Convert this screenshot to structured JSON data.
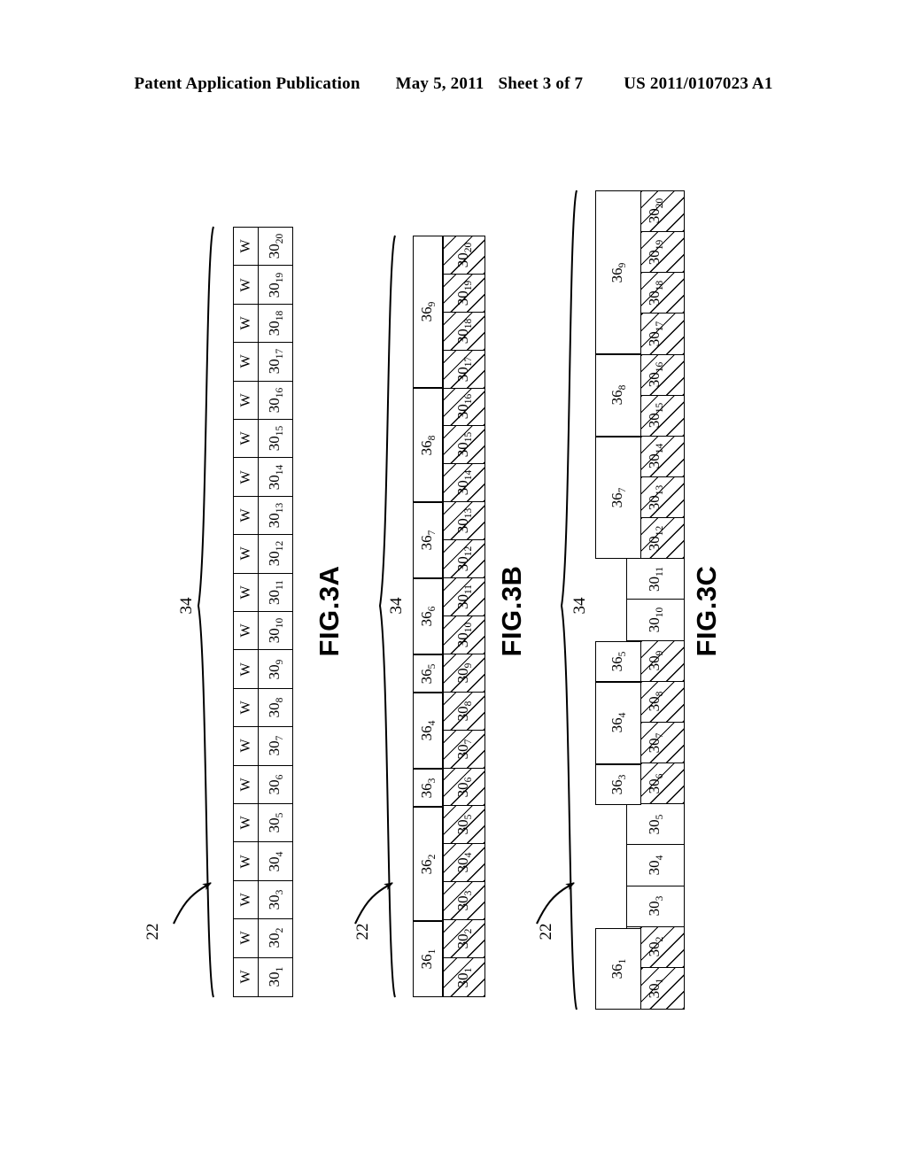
{
  "header": {
    "publication": "Patent Application Publication",
    "date": "May 5, 2011",
    "sheet": "Sheet 3 of 7",
    "patent_number": "US 2011/0107023 A1"
  },
  "figures": [
    {
      "id": "fig3a",
      "caption": "FIG.3A",
      "brace_label": "34",
      "leader_label": "22",
      "cell_w_label": "W",
      "cells": [
        {
          "base": "30",
          "sub": "1",
          "hatched": false,
          "w": true
        },
        {
          "base": "30",
          "sub": "2",
          "hatched": false,
          "w": true
        },
        {
          "base": "30",
          "sub": "3",
          "hatched": false,
          "w": true
        },
        {
          "base": "30",
          "sub": "4",
          "hatched": false,
          "w": true
        },
        {
          "base": "30",
          "sub": "5",
          "hatched": false,
          "w": true
        },
        {
          "base": "30",
          "sub": "6",
          "hatched": false,
          "w": true
        },
        {
          "base": "30",
          "sub": "7",
          "hatched": false,
          "w": true
        },
        {
          "base": "30",
          "sub": "8",
          "hatched": false,
          "w": true
        },
        {
          "base": "30",
          "sub": "9",
          "hatched": false,
          "w": true
        },
        {
          "base": "30",
          "sub": "10",
          "hatched": false,
          "w": true
        },
        {
          "base": "30",
          "sub": "11",
          "hatched": false,
          "w": true
        },
        {
          "base": "30",
          "sub": "12",
          "hatched": false,
          "w": true
        },
        {
          "base": "30",
          "sub": "13",
          "hatched": false,
          "w": true
        },
        {
          "base": "30",
          "sub": "14",
          "hatched": false,
          "w": true
        },
        {
          "base": "30",
          "sub": "15",
          "hatched": false,
          "w": true
        },
        {
          "base": "30",
          "sub": "16",
          "hatched": false,
          "w": true
        },
        {
          "base": "30",
          "sub": "17",
          "hatched": false,
          "w": true
        },
        {
          "base": "30",
          "sub": "18",
          "hatched": false,
          "w": true
        },
        {
          "base": "30",
          "sub": "19",
          "hatched": false,
          "w": true
        },
        {
          "base": "30",
          "sub": "20",
          "hatched": false,
          "w": true
        }
      ],
      "groups": []
    },
    {
      "id": "fig3b",
      "caption": "FIG.3B",
      "brace_label": "34",
      "leader_label": "22",
      "cell_w_label": "",
      "cells": [
        {
          "base": "30",
          "sub": "1",
          "hatched": true,
          "w": false
        },
        {
          "base": "30",
          "sub": "2",
          "hatched": true,
          "w": false
        },
        {
          "base": "30",
          "sub": "3",
          "hatched": true,
          "w": false
        },
        {
          "base": "30",
          "sub": "4",
          "hatched": true,
          "w": false
        },
        {
          "base": "30",
          "sub": "5",
          "hatched": true,
          "w": false
        },
        {
          "base": "30",
          "sub": "6",
          "hatched": true,
          "w": false
        },
        {
          "base": "30",
          "sub": "7",
          "hatched": true,
          "w": false
        },
        {
          "base": "30",
          "sub": "8",
          "hatched": true,
          "w": false
        },
        {
          "base": "30",
          "sub": "9",
          "hatched": true,
          "w": false
        },
        {
          "base": "30",
          "sub": "10",
          "hatched": true,
          "w": false
        },
        {
          "base": "30",
          "sub": "11",
          "hatched": true,
          "w": false
        },
        {
          "base": "30",
          "sub": "12",
          "hatched": true,
          "w": false
        },
        {
          "base": "30",
          "sub": "13",
          "hatched": true,
          "w": false
        },
        {
          "base": "30",
          "sub": "14",
          "hatched": true,
          "w": false
        },
        {
          "base": "30",
          "sub": "15",
          "hatched": true,
          "w": false
        },
        {
          "base": "30",
          "sub": "16",
          "hatched": true,
          "w": false
        },
        {
          "base": "30",
          "sub": "17",
          "hatched": true,
          "w": false
        },
        {
          "base": "30",
          "sub": "18",
          "hatched": true,
          "w": false
        },
        {
          "base": "30",
          "sub": "19",
          "hatched": true,
          "w": false
        },
        {
          "base": "30",
          "sub": "20",
          "hatched": true,
          "w": false
        }
      ],
      "groups": [
        {
          "base": "36",
          "sub": "1",
          "span": 2,
          "present": true,
          "hatched": true
        },
        {
          "base": "36",
          "sub": "2",
          "span": 3,
          "present": true,
          "hatched": true
        },
        {
          "base": "36",
          "sub": "3",
          "span": 1,
          "present": true,
          "hatched": true
        },
        {
          "base": "36",
          "sub": "4",
          "span": 2,
          "present": true,
          "hatched": true
        },
        {
          "base": "36",
          "sub": "5",
          "span": 1,
          "present": true,
          "hatched": true
        },
        {
          "base": "36",
          "sub": "6",
          "span": 2,
          "present": true,
          "hatched": true
        },
        {
          "base": "36",
          "sub": "7",
          "span": 2,
          "present": true,
          "hatched": true
        },
        {
          "base": "36",
          "sub": "8",
          "span": 3,
          "present": true,
          "hatched": true
        },
        {
          "base": "36",
          "sub": "9",
          "span": 4,
          "present": true,
          "hatched": true
        }
      ]
    },
    {
      "id": "fig3c",
      "caption": "FIG.3C",
      "brace_label": "34",
      "leader_label": "22",
      "cell_w_label": "",
      "cells": [
        {
          "base": "30",
          "sub": "1",
          "hatched": true,
          "w": false
        },
        {
          "base": "30",
          "sub": "2",
          "hatched": true,
          "w": false
        },
        {
          "base": "30",
          "sub": "3",
          "hatched": false,
          "w": false
        },
        {
          "base": "30",
          "sub": "4",
          "hatched": false,
          "w": false
        },
        {
          "base": "30",
          "sub": "5",
          "hatched": false,
          "w": false
        },
        {
          "base": "30",
          "sub": "6",
          "hatched": true,
          "w": false
        },
        {
          "base": "30",
          "sub": "7",
          "hatched": true,
          "w": false
        },
        {
          "base": "30",
          "sub": "8",
          "hatched": true,
          "w": false
        },
        {
          "base": "30",
          "sub": "9",
          "hatched": true,
          "w": false
        },
        {
          "base": "30",
          "sub": "10",
          "hatched": false,
          "w": false
        },
        {
          "base": "30",
          "sub": "11",
          "hatched": false,
          "w": false
        },
        {
          "base": "30",
          "sub": "12",
          "hatched": true,
          "w": false
        },
        {
          "base": "30",
          "sub": "13",
          "hatched": true,
          "w": false
        },
        {
          "base": "30",
          "sub": "14",
          "hatched": true,
          "w": false
        },
        {
          "base": "30",
          "sub": "15",
          "hatched": true,
          "w": false
        },
        {
          "base": "30",
          "sub": "16",
          "hatched": true,
          "w": false
        },
        {
          "base": "30",
          "sub": "17",
          "hatched": true,
          "w": false
        },
        {
          "base": "30",
          "sub": "18",
          "hatched": true,
          "w": false
        },
        {
          "base": "30",
          "sub": "19",
          "hatched": true,
          "w": false
        },
        {
          "base": "30",
          "sub": "20",
          "hatched": true,
          "w": false
        }
      ],
      "groups": [
        {
          "base": "36",
          "sub": "1",
          "span": 2,
          "present": true,
          "hatched": false
        },
        {
          "base": "36",
          "sub": "2",
          "span": 3,
          "present": false,
          "hatched": false
        },
        {
          "base": "36",
          "sub": "3",
          "span": 1,
          "present": true,
          "hatched": false
        },
        {
          "base": "36",
          "sub": "4",
          "span": 2,
          "present": true,
          "hatched": false
        },
        {
          "base": "36",
          "sub": "5",
          "span": 1,
          "present": true,
          "hatched": false
        },
        {
          "base": "36",
          "sub": "6",
          "span": 2,
          "present": false,
          "hatched": false
        },
        {
          "base": "36",
          "sub": "7",
          "span": 3,
          "present": true,
          "hatched": false
        },
        {
          "base": "36",
          "sub": "8",
          "span": 2,
          "present": true,
          "hatched": false
        },
        {
          "base": "36",
          "sub": "9",
          "span": 4,
          "present": true,
          "hatched": false
        }
      ]
    }
  ],
  "colors": {
    "ink": "#000000",
    "paper": "#ffffff"
  }
}
